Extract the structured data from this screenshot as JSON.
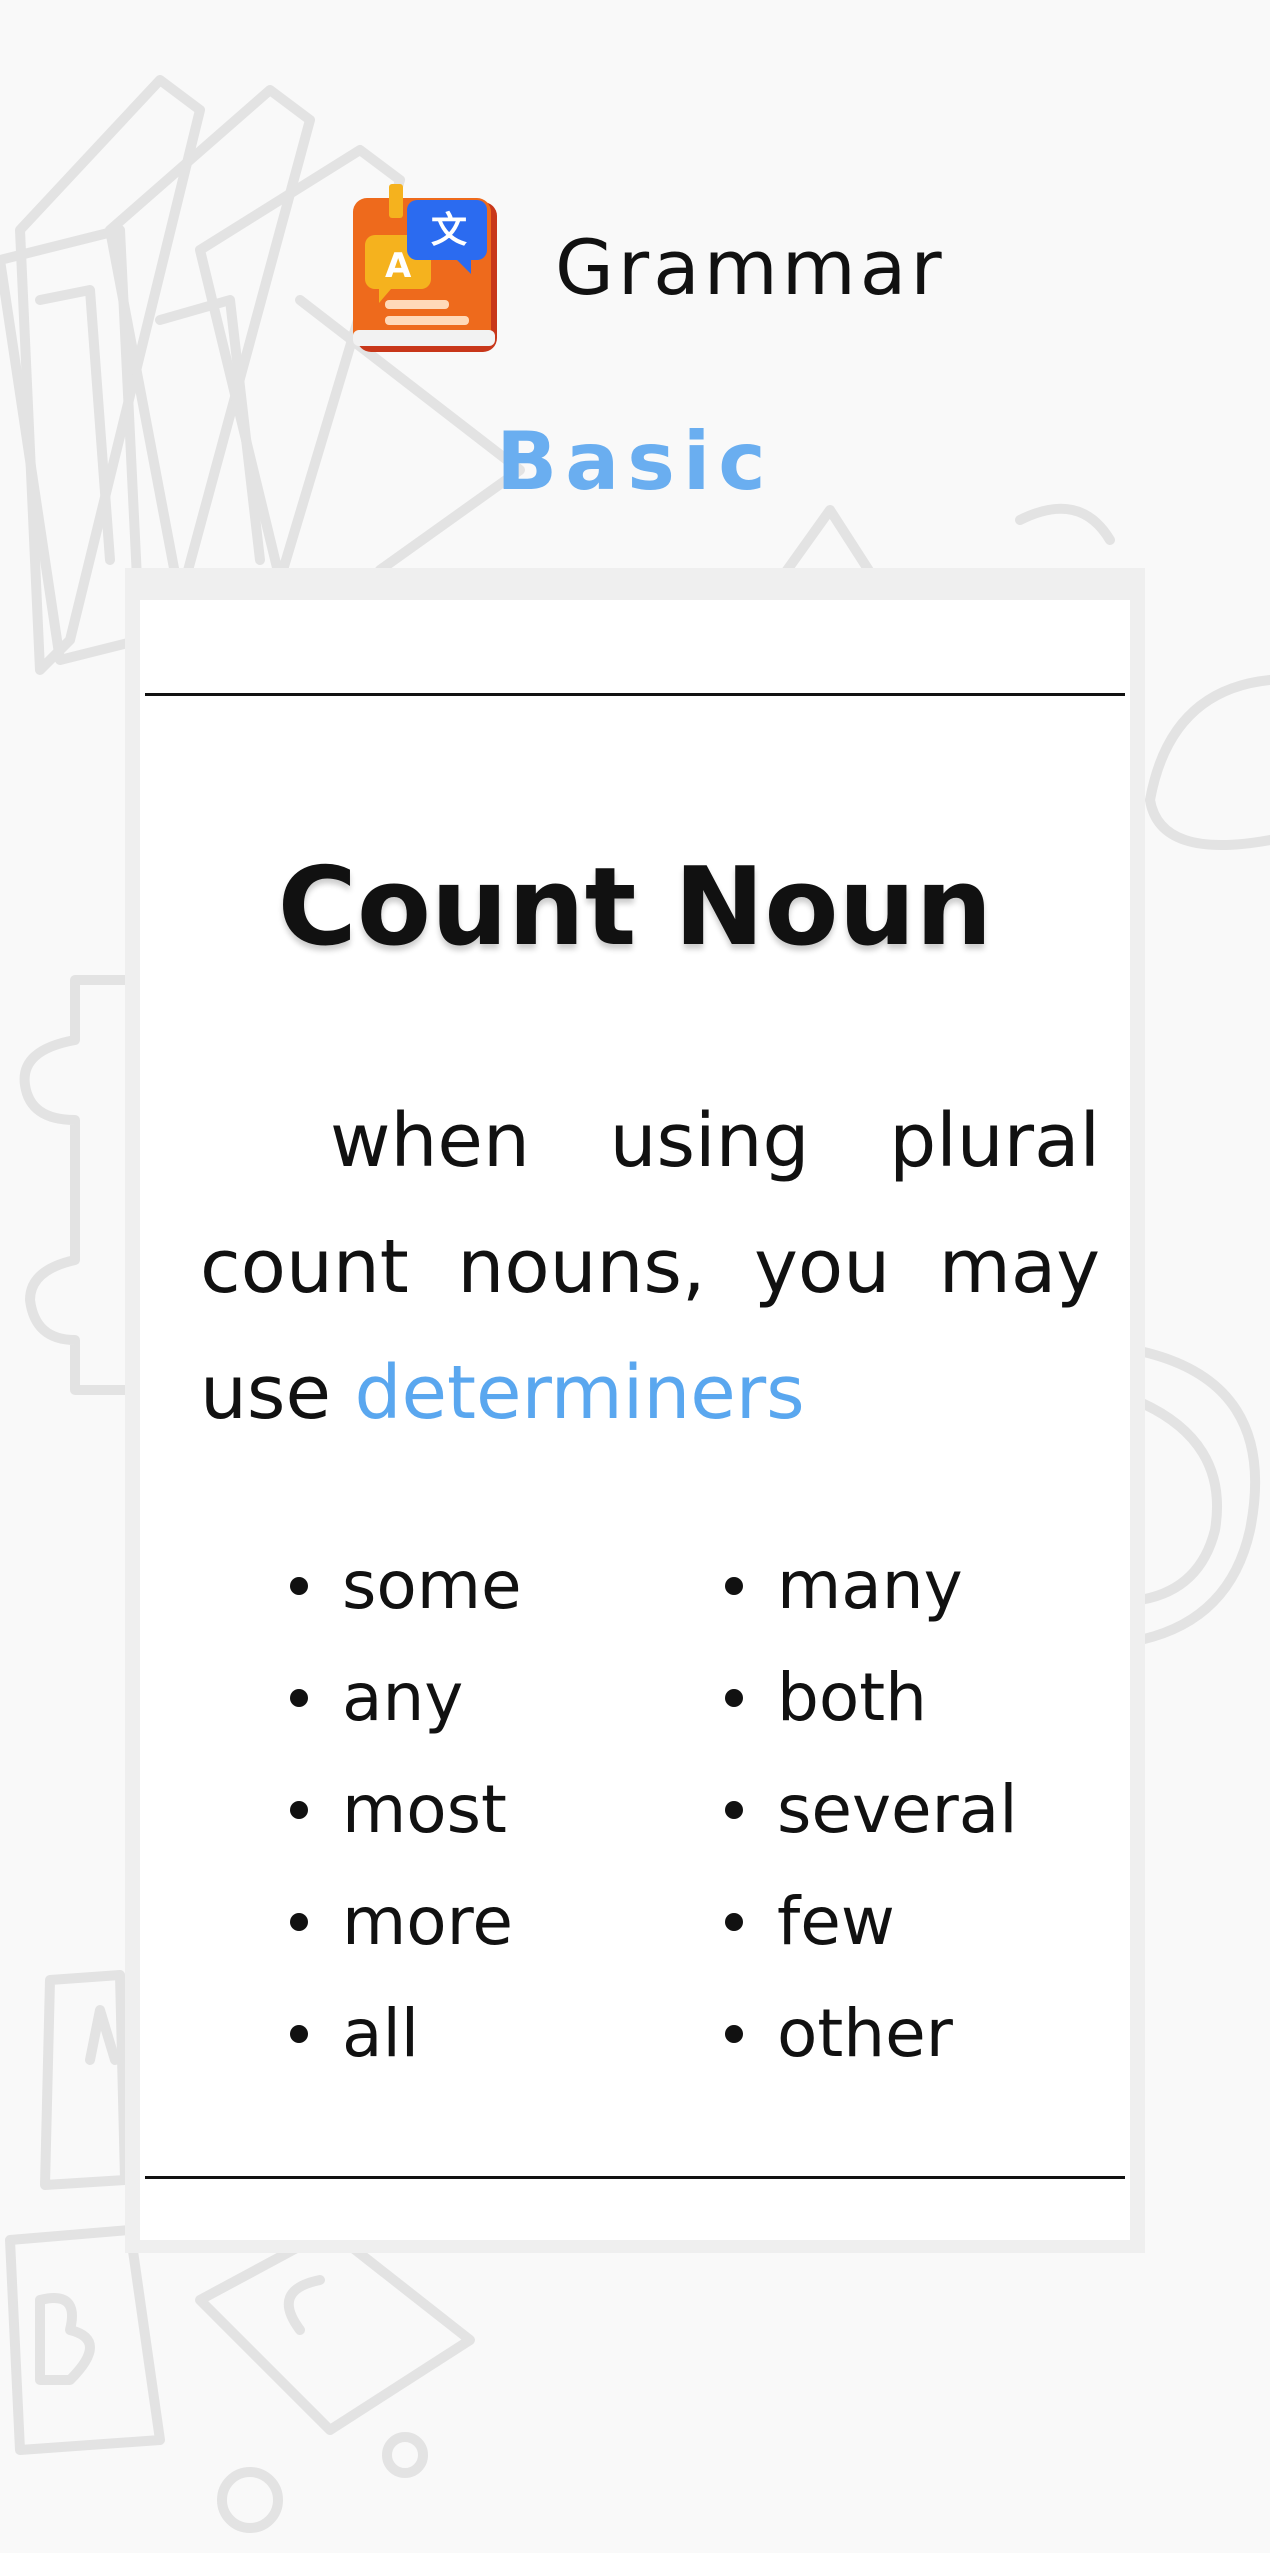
{
  "header": {
    "title": "Grammar",
    "icon": "translate-book-icon",
    "icon_colors": {
      "book": "#ee6a1c",
      "bubble_blue": "#2b6bf0",
      "bubble_yellow": "#f5b21e"
    }
  },
  "level": "Basic",
  "card": {
    "title": "Count Noun",
    "text_lead": "when using plural count nouns, you may use ",
    "text_highlight": "determiners",
    "determiners_left": [
      "some",
      "any",
      "most",
      "more",
      "all"
    ],
    "determiners_right": [
      "many",
      "both",
      "several",
      "few",
      "other"
    ]
  },
  "colors": {
    "accent": "#5aa7ef",
    "level": "#6aaef0",
    "background": "#f9f9f9"
  }
}
